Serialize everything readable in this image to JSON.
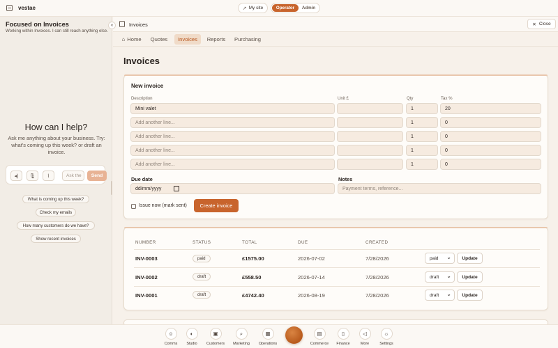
{
  "topbar": {
    "brand": "vestae",
    "mysite_label": "My site",
    "roles": [
      "Operator",
      "Admin"
    ],
    "active_role": "Operator"
  },
  "assistant": {
    "title": "Focused on Invoices",
    "subtitle": "Working within Invoices. I can still reach anything else.",
    "collapse_icon": "«",
    "heading": "How can I help?",
    "hint": "Ask me anything about your business. Try: what's coming up this week? or draft an invoice.",
    "input_placeholder": "Ask the",
    "send_label": "Send",
    "suggestions": [
      "What is coming up this week?",
      "Check my emails",
      "How many customers do we have?",
      "Show recent invoices"
    ]
  },
  "header": {
    "title": "Invoices",
    "close_label": "Close",
    "close_icon": "✕"
  },
  "tabs": [
    {
      "label": "Home",
      "icon": "home-icon"
    },
    {
      "label": "Quotes"
    },
    {
      "label": "Invoices"
    },
    {
      "label": "Reports"
    },
    {
      "label": "Purchasing"
    }
  ],
  "active_tab": "Invoices",
  "page_title": "Invoices",
  "new_invoice": {
    "title": "New invoice",
    "columns": {
      "description": "Description",
      "unit": "Unit £",
      "qty": "Qty",
      "tax": "Tax %"
    },
    "lines": [
      {
        "description": "Mini valet",
        "unit": "",
        "qty": "1",
        "tax": "20"
      },
      {
        "description": "Add another line...",
        "unit": "",
        "qty": "1",
        "tax": "0"
      },
      {
        "description": "Add another line...",
        "unit": "",
        "qty": "1",
        "tax": "0"
      },
      {
        "description": "Add another line...",
        "unit": "",
        "qty": "1",
        "tax": "0"
      },
      {
        "description": "Add another line...",
        "unit": "",
        "qty": "1",
        "tax": "0"
      }
    ],
    "due_date_label": "Due date",
    "due_date_placeholder": "dd/mm/yyyy",
    "notes_label": "Notes",
    "notes_placeholder": "Payment terms, reference...",
    "issue_now_label": "Issue now (mark sent)",
    "create_label": "Create invoice"
  },
  "invoices_table": {
    "headers": [
      "NUMBER",
      "STATUS",
      "TOTAL",
      "DUE",
      "CREATED"
    ],
    "update_label": "Update",
    "rows": [
      {
        "number": "INV-0003",
        "status": "paid",
        "total": "£1575.00",
        "due": "2026-07-02",
        "created": "7/28/2026",
        "select": "paid"
      },
      {
        "number": "INV-0002",
        "status": "draft",
        "total": "£558.50",
        "due": "2026-07-14",
        "created": "7/28/2026",
        "select": "draft"
      },
      {
        "number": "INV-0001",
        "status": "draft",
        "total": "£4742.40",
        "due": "2026-08-19",
        "created": "7/28/2026",
        "select": "draft"
      }
    ]
  },
  "dock": [
    {
      "label": "Comms",
      "icon": "people-icon",
      "glyph": "☺"
    },
    {
      "label": "Studio",
      "icon": "palette-icon",
      "glyph": "◐"
    },
    {
      "label": "Customers",
      "icon": "customers-icon",
      "glyph": "▣"
    },
    {
      "label": "Marketing",
      "icon": "search-icon",
      "glyph": "⌕"
    },
    {
      "label": "Operations",
      "icon": "calendar-icon",
      "glyph": "▦"
    },
    {
      "label": "Commerce",
      "icon": "store-icon",
      "glyph": "▤"
    },
    {
      "label": "Finance",
      "icon": "document-icon",
      "glyph": "▯"
    },
    {
      "label": "More",
      "icon": "megaphone-icon",
      "glyph": "◁"
    },
    {
      "label": "Settings",
      "icon": "gear-icon",
      "glyph": "☼"
    }
  ],
  "colors": {
    "accent": "#c8642c",
    "tab_active_bg": "#f0dbc8",
    "background": "#f7f1ea",
    "field_bg": "#f6ebe0"
  }
}
